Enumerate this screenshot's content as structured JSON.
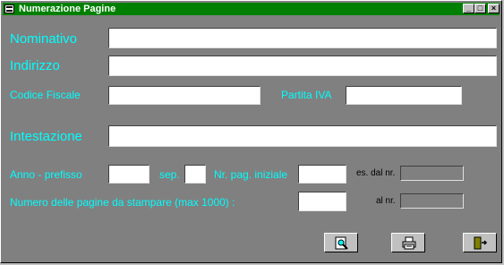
{
  "window": {
    "title": "Numerazione Pagine"
  },
  "controls": {
    "minimize": "_",
    "maximize": "□",
    "close": "×"
  },
  "labels": {
    "nominativo": "Nominativo",
    "indirizzo": "Indirizzo",
    "codice_fiscale": "Codice Fiscale",
    "partita_iva": "Partita IVA",
    "intestazione": "Intestazione",
    "anno_prefisso": "Anno - prefisso",
    "sep": "sep.",
    "nr_pag_iniziale": "Nr. pag. iniziale",
    "es_dal_nr": "es.  dal nr.",
    "numero_pagine": "Numero delle pagine da stampare (max 1000) :",
    "al_nr": "al nr."
  },
  "fields": {
    "nominativo": "",
    "indirizzo": "",
    "codice_fiscale": "",
    "partita_iva": "",
    "intestazione": "",
    "anno_prefisso": "",
    "sep": "",
    "nr_pag_iniziale": "",
    "dal_nr": "",
    "numero_pagine": "",
    "al_nr": ""
  },
  "buttons": [
    {
      "name": "preview-button",
      "icon": "magnifier-page-icon"
    },
    {
      "name": "print-button",
      "icon": "printer-icon"
    },
    {
      "name": "exit-button",
      "icon": "exit-door-icon"
    }
  ],
  "colors": {
    "titlebar": "#008000",
    "body": "#808080",
    "label": "#00ffff"
  }
}
